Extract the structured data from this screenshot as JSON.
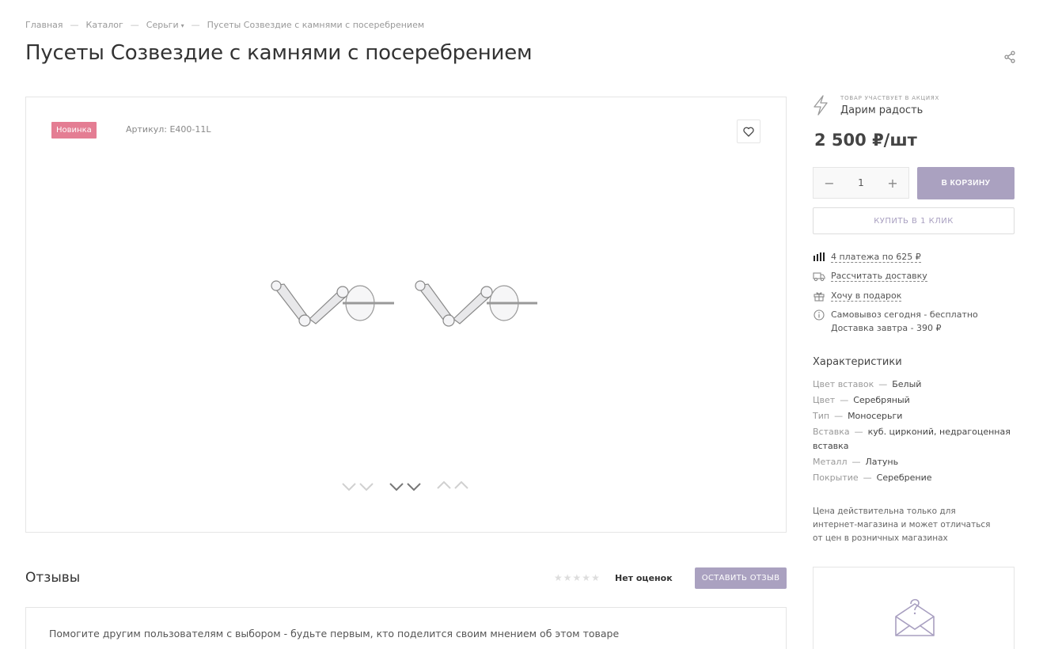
{
  "breadcrumb": {
    "items": [
      "Главная",
      "Каталог",
      "Серьги",
      "Пусеты Созвездие с камнями с посеребрением"
    ],
    "separator": "—"
  },
  "product": {
    "title": "Пусеты Созвездие с камнями с посеребрением",
    "badge": "Новинка",
    "article": "Артикул: E400-11L",
    "quantity": "1",
    "price": "2 500 ₽/шт"
  },
  "promo": {
    "caption": "Товар участвует в акциях",
    "name": "Дарим радость"
  },
  "buttons": {
    "cart": "В КОРЗИНУ",
    "one_click": "КУПИТЬ В 1 КЛИК",
    "minus": "−",
    "plus": "+"
  },
  "info": {
    "installments": "4 платежа по 625 ₽",
    "delivery_calc": "Рассчитать доставку",
    "gift": "Хочу в подарок",
    "pickup": "Самовывоз сегодня - бесплатно",
    "delivery": "Доставка завтра - 390 ₽"
  },
  "specs": {
    "title": "Характеристики",
    "items": [
      {
        "key": "Цвет вставок",
        "value": "Белый"
      },
      {
        "key": "Цвет",
        "value": "Серебряный"
      },
      {
        "key": "Тип",
        "value": "Моносерьги"
      },
      {
        "key": "Вставка",
        "value": "куб. цирконий, недрагоценная вставка"
      },
      {
        "key": "Металл",
        "value": "Латунь"
      },
      {
        "key": "Покрытие",
        "value": "Серебрение"
      }
    ],
    "dash": "—"
  },
  "price_note": "Цена действительна только для интернет-магазина и может отличаться от цен в розничных магазинах",
  "reviews": {
    "title": "Отзывы",
    "rating_text": "Нет оценок",
    "rating_value": 0,
    "rating_max": 5,
    "button": "ОСТАВИТЬ ОТЗЫВ",
    "prompt": "Помогите другим пользователям с выбором - будьте первым, кто поделится своим мнением об этом товаре"
  },
  "colors": {
    "accent": "#aaa1c0",
    "badge": "#e47d93"
  },
  "icons": [
    "share-icon",
    "heart-icon",
    "bolt-icon",
    "installment-icon",
    "truck-icon",
    "gift-icon",
    "info-icon",
    "envelope-question-icon",
    "star-icon"
  ]
}
